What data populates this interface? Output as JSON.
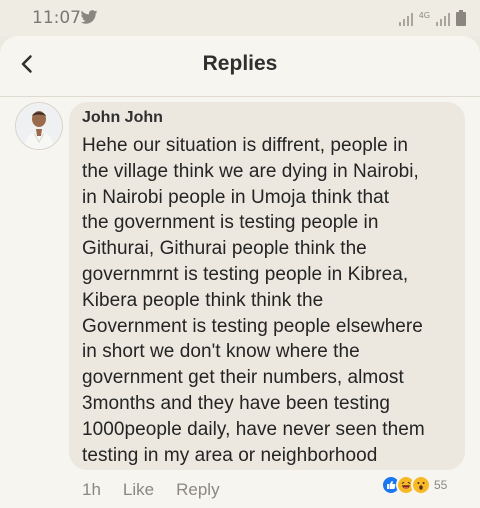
{
  "status_bar": {
    "time": "11:07",
    "network_label": "4G"
  },
  "header": {
    "title": "Replies"
  },
  "comment": {
    "author": "John John",
    "text_lines": [
      "Hehe our situation is diffrent, people in",
      "the village think we are dying in Nairobi,",
      "in Nairobi people in Umoja think that",
      "the government is testing people in",
      "Githurai, Githurai people think the",
      "governmrnt is testing people in Kibrea,",
      "Kibera people think think the",
      "Government is testing people elsewhere",
      "in short we don't know where the",
      "government get their numbers, almost",
      "3months and they have been testing",
      "1000people daily, have never seen them",
      "testing in my area or neighborhood"
    ],
    "time_ago": "1h",
    "like_label": "Like",
    "reply_label": "Reply",
    "reaction_count": "55",
    "reaction_icons": [
      "like-reaction-icon",
      "haha-reaction-icon",
      "wow-reaction-icon"
    ]
  },
  "colors": {
    "panel_background": "#f7f5ef",
    "bubble_background": "#ece8df",
    "text": "#242424",
    "muted": "#8a8881"
  }
}
